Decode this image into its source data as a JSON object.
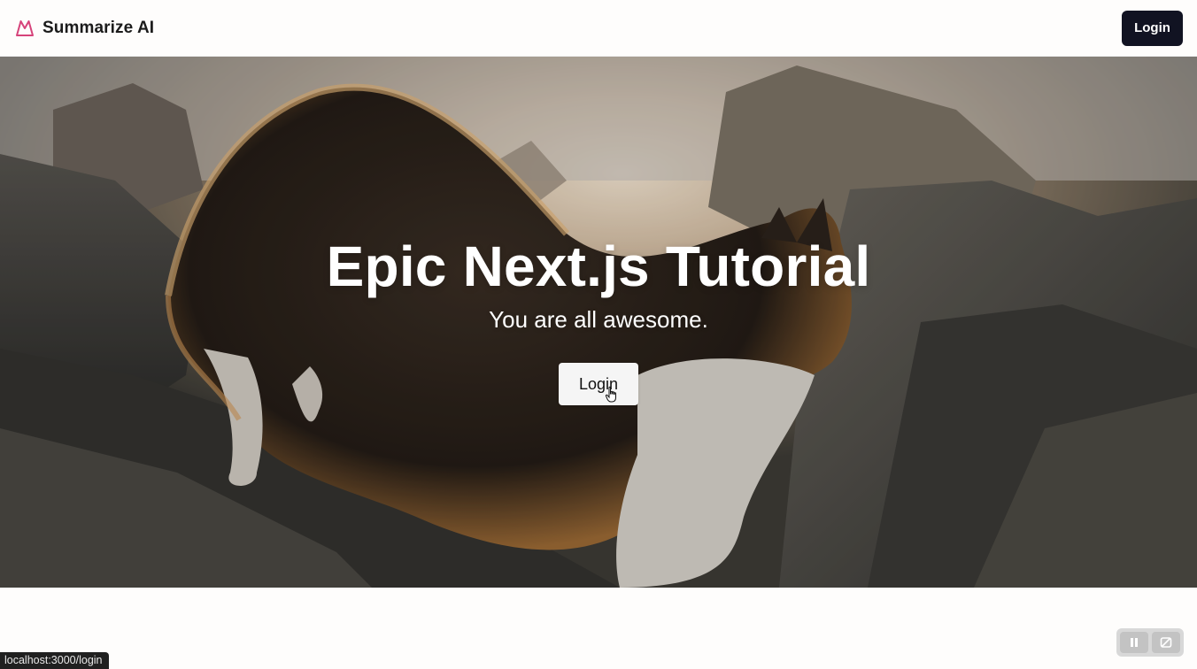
{
  "header": {
    "brand_name": "Summarize AI",
    "login_label": "Login",
    "logo_color": "#d6437a",
    "login_bg": "#111322"
  },
  "hero": {
    "title": "Epic Next.js Tutorial",
    "subtitle": "You are all awesome.",
    "login_label": "Login",
    "background_image": "cat on rocks at sunset"
  },
  "status_bar": {
    "url": "localhost:3000/login"
  },
  "icons": {
    "brand_logo": "mountain-logo-icon",
    "cursor": "hand-pointer-icon",
    "pause": "pause-icon",
    "disable": "slash-icon"
  }
}
